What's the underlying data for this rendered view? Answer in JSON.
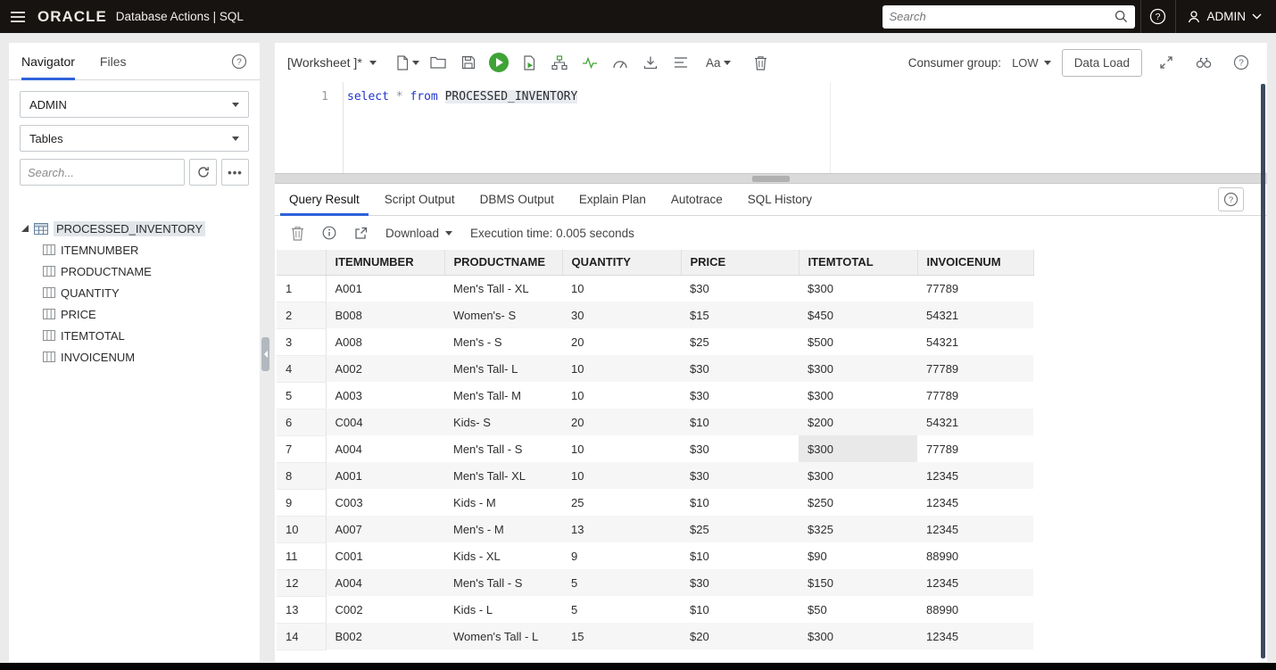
{
  "colors": {
    "accent_blue": "#2e62d9",
    "run_green": "#3fa336",
    "topbar_bg": "#171310"
  },
  "header": {
    "brand": "ORACLE",
    "app_title": "Database Actions | SQL",
    "search_placeholder": "Search",
    "user": "ADMIN"
  },
  "sidebar": {
    "tabs": [
      {
        "label": "Navigator",
        "active": true
      },
      {
        "label": "Files",
        "active": false
      }
    ],
    "schema_select": "ADMIN",
    "object_type_select": "Tables",
    "search_placeholder": "Search...",
    "tree": {
      "root": "PROCESSED_INVENTORY",
      "columns": [
        "ITEMNUMBER",
        "PRODUCTNAME",
        "QUANTITY",
        "PRICE",
        "ITEMTOTAL",
        "INVOICENUM"
      ]
    }
  },
  "worksheet": {
    "title": "[Worksheet ]*",
    "font_label": "Aa",
    "consumer_group_label": "Consumer group:",
    "consumer_group_value": "LOW",
    "data_load_label": "Data Load",
    "code": {
      "line_number": "1",
      "tokens": [
        {
          "text": "select",
          "type": "keyword"
        },
        {
          "text": " ",
          "type": "plain"
        },
        {
          "text": "*",
          "type": "operator"
        },
        {
          "text": " ",
          "type": "plain"
        },
        {
          "text": "from",
          "type": "keyword"
        },
        {
          "text": " ",
          "type": "plain"
        },
        {
          "text": "PROCESSED_INVENTORY",
          "type": "ident"
        }
      ]
    }
  },
  "results": {
    "tabs": [
      "Query Result",
      "Script Output",
      "DBMS Output",
      "Explain Plan",
      "Autotrace",
      "SQL History"
    ],
    "active_tab": "Query Result",
    "download_label": "Download",
    "execution_time": "Execution time: 0.005 seconds",
    "table": {
      "columns": [
        "ITEMNUMBER",
        "PRODUCTNAME",
        "QUANTITY",
        "PRICE",
        "ITEMTOTAL",
        "INVOICENUM"
      ],
      "selected_cell": {
        "row": 6,
        "col": 4
      },
      "rows": [
        [
          "A001",
          "Men's Tall - XL",
          "10",
          "$30",
          "$300",
          "77789"
        ],
        [
          "B008",
          "Women's- S",
          "30",
          "$15",
          "$450",
          "54321"
        ],
        [
          "A008",
          "Men's - S",
          "20",
          "$25",
          "$500",
          "54321"
        ],
        [
          "A002",
          "Men's Tall- L",
          "10",
          "$30",
          "$300",
          "77789"
        ],
        [
          "A003",
          "Men's Tall- M",
          "10",
          "$30",
          "$300",
          "77789"
        ],
        [
          "C004",
          "Kids- S",
          "20",
          "$10",
          "$200",
          "54321"
        ],
        [
          "A004",
          "Men's Tall - S",
          "10",
          "$30",
          "$300",
          "77789"
        ],
        [
          "A001",
          "Men's Tall- XL",
          "10",
          "$30",
          "$300",
          "12345"
        ],
        [
          "C003",
          "Kids - M",
          "25",
          "$10",
          "$250",
          "12345"
        ],
        [
          "A007",
          "Men's - M",
          "13",
          "$25",
          "$325",
          "12345"
        ],
        [
          "C001",
          "Kids - XL",
          "9",
          "$10",
          "$90",
          "88990"
        ],
        [
          "A004",
          "Men's Tall - S",
          "5",
          "$30",
          "$150",
          "12345"
        ],
        [
          "C002",
          "Kids - L",
          "5",
          "$10",
          "$50",
          "88990"
        ],
        [
          "B002",
          "Women's Tall - L",
          "15",
          "$20",
          "$300",
          "12345"
        ]
      ]
    }
  }
}
